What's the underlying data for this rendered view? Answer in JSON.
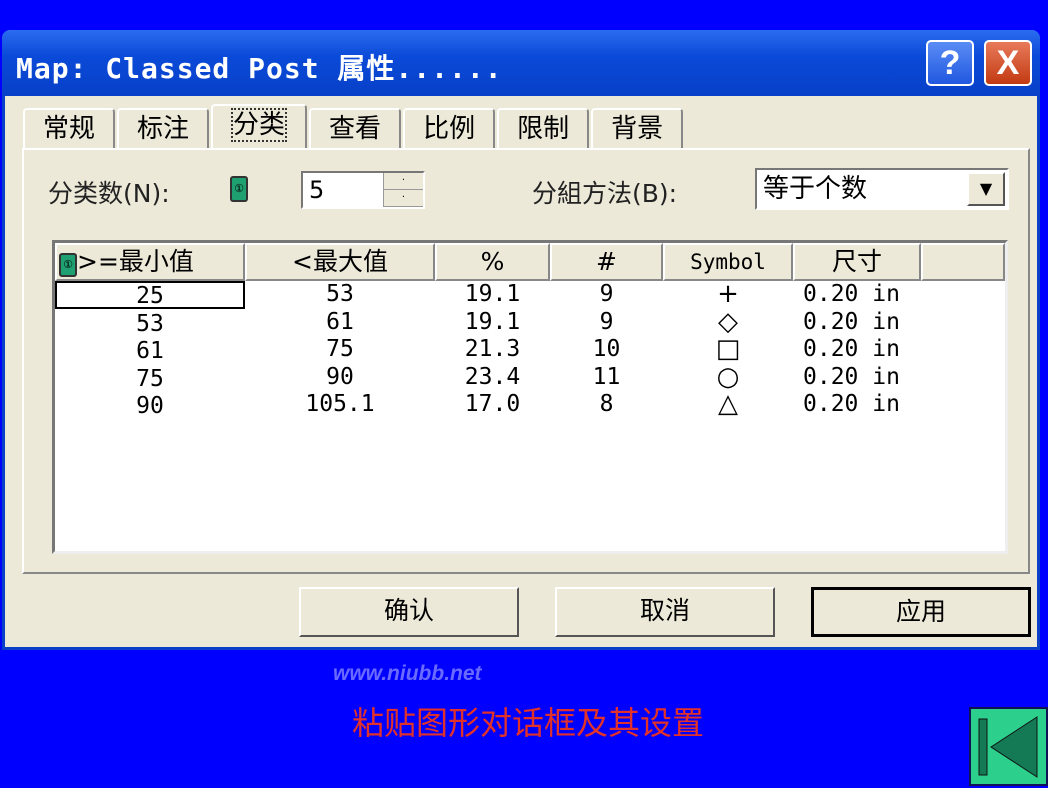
{
  "window": {
    "title": "Map: Classed Post 属性......",
    "help": "?",
    "close": "X"
  },
  "tabs": [
    "常规",
    "标注",
    "分类",
    "查看",
    "比例",
    "限制",
    "背景"
  ],
  "active_tab": "分类",
  "controls": {
    "class_count_label": "分类数(N):",
    "class_count_value": "5",
    "group_method_label": "分組方法(B):",
    "group_method_value": "等于个数"
  },
  "table": {
    "headers": [
      ">=最小值",
      "<最大值",
      "%",
      "#",
      "Symbol",
      "尺寸",
      ""
    ],
    "rows": [
      [
        "25",
        "53",
        "19.1",
        "9",
        "+",
        "0.20 in"
      ],
      [
        "53",
        "61",
        "19.1",
        "9",
        "◇",
        "0.20 in"
      ],
      [
        "61",
        "75",
        "21.3",
        "10",
        "□",
        "0.20 in"
      ],
      [
        "75",
        "90",
        "23.4",
        "11",
        "○",
        "0.20 in"
      ],
      [
        "90",
        "105.1",
        "17.0",
        "8",
        "△",
        "0.20 in"
      ]
    ]
  },
  "buttons": {
    "ok": "确认",
    "cancel": "取消",
    "apply": "应用"
  },
  "watermark": "www.niubb.net",
  "caption": "粘贴图形对话框及其设置",
  "colors": {
    "background": "#0000fe",
    "caption": "#e0312a",
    "nav": "#2dcf8c"
  }
}
